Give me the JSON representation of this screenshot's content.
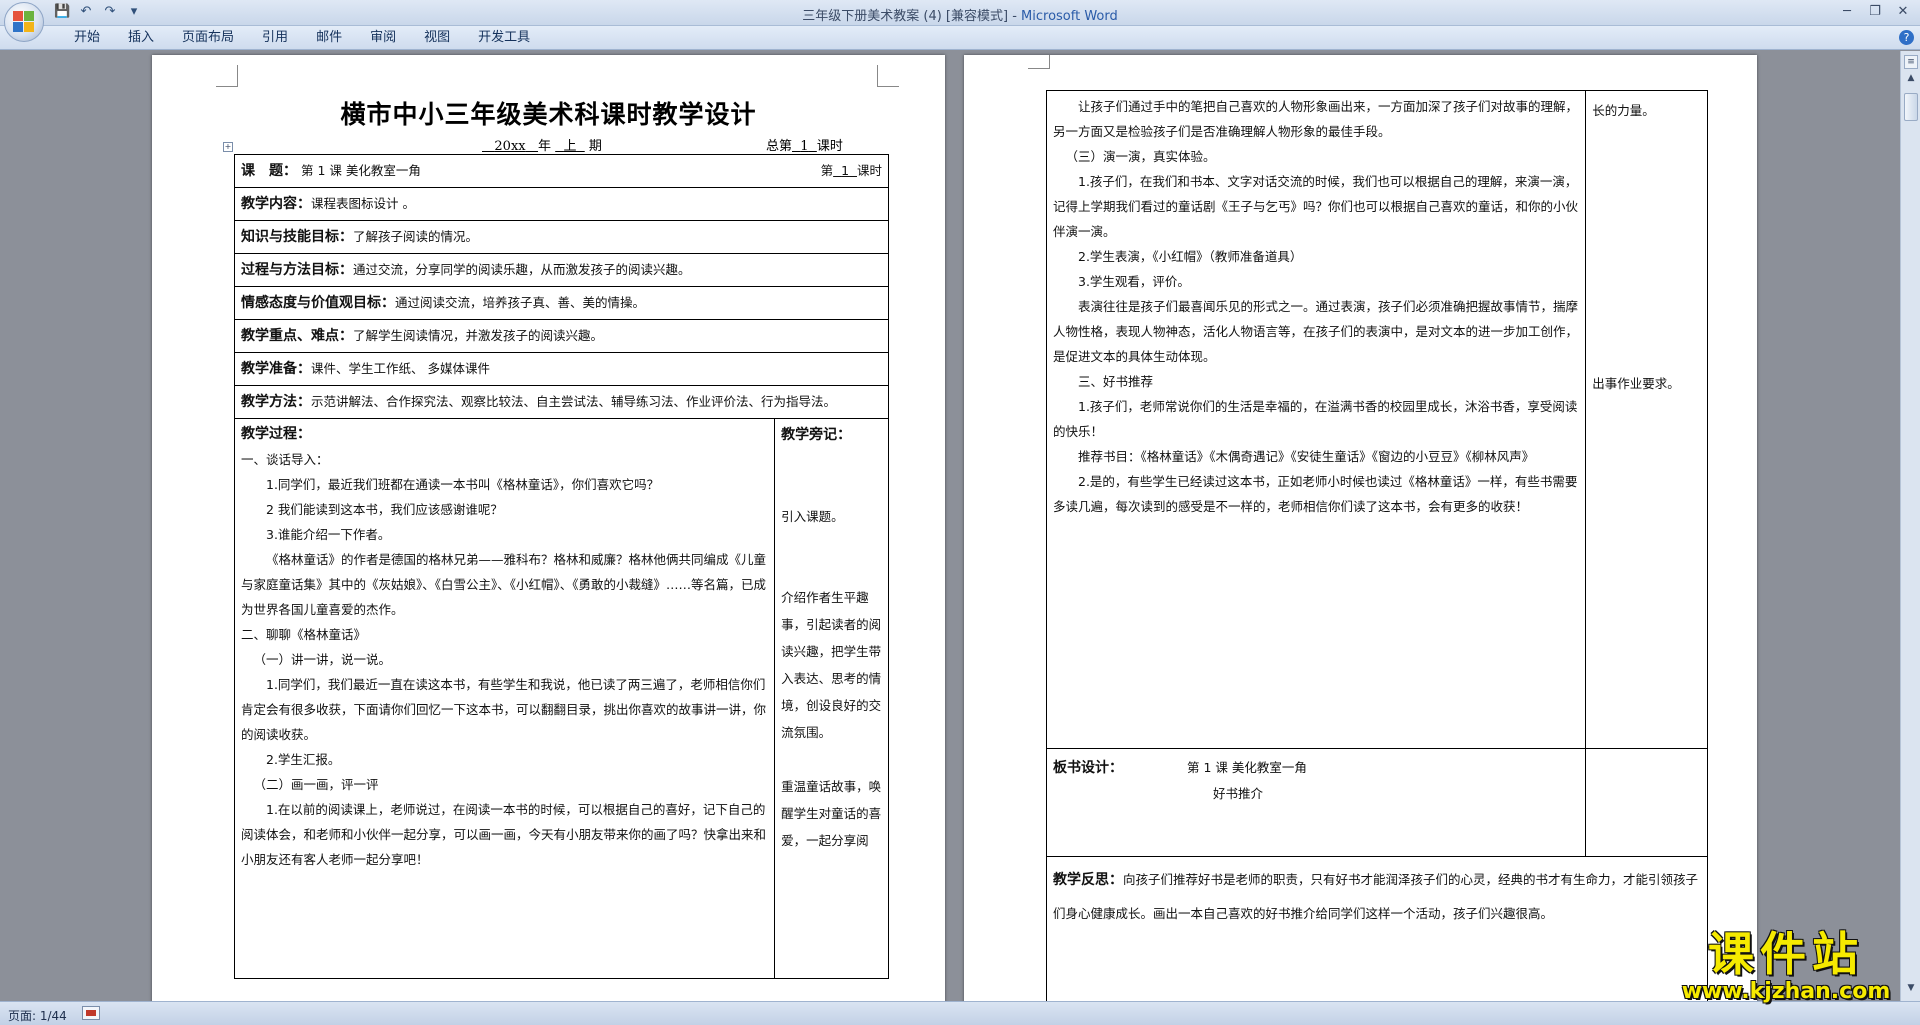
{
  "window": {
    "title": "三年级下册美术教案 (4) [兼容模式]",
    "app_name": "Microsoft Word",
    "title_sep": " - "
  },
  "ribbon": {
    "tabs": [
      "开始",
      "插入",
      "页面布局",
      "引用",
      "邮件",
      "审阅",
      "视图",
      "开发工具"
    ]
  },
  "status": {
    "page": "页面: 1/44"
  },
  "doc": {
    "title": "横市中小三年级美术科课时教学设计",
    "term": {
      "year": "20xx",
      "year_suffix": "年",
      "half": "上",
      "half_suffix": "期",
      "total_prefix": "总第",
      "total_num": "1",
      "total_suffix": "课时"
    },
    "topic_label": "课　题：",
    "topic_value": "第 1 课 美化教室一角",
    "lesson_prefix": "第",
    "lesson_num": "1",
    "lesson_suffix": "课时",
    "rows": [
      {
        "label": "教学内容：",
        "value": "课程表图标设计 。"
      },
      {
        "label": "知识与技能目标：",
        "value": "了解孩子阅读的情况。"
      },
      {
        "label": "过程与方法目标：",
        "value": "通过交流，分享同学的阅读乐趣，从而激发孩子的阅读兴趣。"
      },
      {
        "label": "情感态度与价值观目标：",
        "value": "通过阅读交流，培养孩子真、善、美的情操。"
      },
      {
        "label": "教学重点、难点：",
        "value": "了解学生阅读情况，并激发孩子的阅读兴趣。"
      },
      {
        "label": "教学准备：",
        "value": "课件、学生工作纸、 多媒体课件"
      },
      {
        "label": "教学方法：",
        "value": "示范讲解法、合作探究法、观察比较法、自主尝试法、辅导练习法、作业评价法、行为指导法。"
      }
    ],
    "process_label": "教学过程：",
    "notes_label": "教学旁记：",
    "process": [
      {
        "cls": "",
        "text": "一、谈话导入："
      },
      {
        "cls": "sub",
        "text": "1.同学们，最近我们班都在通读一本书叫《格林童话》，你们喜欢它吗？"
      },
      {
        "cls": "sub",
        "text": "2 我们能读到这本书，我们应该感谢谁呢？"
      },
      {
        "cls": "sub",
        "text": "3.谁能介绍一下作者。"
      },
      {
        "cls": "para",
        "text": "《格林童话》的作者是德国的格林兄弟——雅科布？格林和威廉？格林他俩共同编成《儿童与家庭童话集》其中的《灰姑娘》、《白雪公主》、《小红帽》、《勇敢的小裁缝》……等名篇，已成为世界各国儿童喜爱的杰作。"
      },
      {
        "cls": "",
        "text": "二、聊聊《格林童话》"
      },
      {
        "cls": "sub2",
        "text": "（一）讲一讲，说一说。"
      },
      {
        "cls": "para",
        "text": "1.同学们，我们最近一直在读这本书，有些学生和我说，他已读了两三遍了，老师相信你们肯定会有很多收获，下面请你们回忆一下这本书，可以翻翻目录，挑出你喜欢的故事讲一讲，你的阅读收获。"
      },
      {
        "cls": "sub",
        "text": "2.学生汇报。"
      },
      {
        "cls": "sub2",
        "text": "（二）画一画，评一评"
      },
      {
        "cls": "para",
        "text": "1.在以前的阅读课上，老师说过，在阅读一本书的时候，可以根据自己的喜好，记下自己的阅读体会，和老师和小伙伴一起分享，可以画一画，今天有小朋友带来你的画了吗？快拿出来和小朋友还有客人老师一起分享吧！"
      }
    ],
    "notes": [
      {
        "gap": 2,
        "text": "引入课题。"
      },
      {
        "gap": 2,
        "text": "介绍作者生平趣事，引起读者的阅读兴趣，把学生带入表达、思考的情境，创设良好的交流氛围。"
      },
      {
        "gap": 1,
        "text": "重温童话故事，唤醒学生对童话的喜爱，一起分享阅"
      }
    ]
  },
  "doc2": {
    "main": [
      {
        "cls": "para",
        "text": "让孩子们通过手中的笔把自己喜欢的人物形象画出来，一方面加深了孩子们对故事的理解，另一方面又是检验孩子们是否准确理解人物形象的最佳手段。"
      },
      {
        "cls": "sub2",
        "text": "（三）演一演，真实体验。"
      },
      {
        "cls": "para",
        "text": "1.孩子们，在我们和书本、文字对话交流的时候，我们也可以根据自己的理解，来演一演，记得上学期我们看过的童话剧《王子与乞丐》吗？你们也可以根据自己喜欢的童话，和你的小伙伴演一演。"
      },
      {
        "cls": "sub",
        "text": "2.学生表演，《小红帽》（教师准备道具）"
      },
      {
        "cls": "sub",
        "text": "3.学生观看，评价。"
      },
      {
        "cls": "para",
        "text": "表演往往是孩子们最喜闻乐见的形式之一。通过表演，孩子们必须准确把握故事情节，揣摩人物性格，表现人物神态，活化人物语言等，在孩子们的表演中，是对文本的进一步加工创作，是促进文本的具体生动体现。"
      },
      {
        "cls": "sub",
        "text": "三、好书推荐"
      },
      {
        "cls": "para",
        "text": "1.孩子们，老师常说你们的生活是幸福的，在溢满书香的校园里成长，沐浴书香，享受阅读的快乐！"
      },
      {
        "cls": "para",
        "text": "推荐书目：《格林童话》《木偶奇遇记》《安徒生童话》《窗边的小豆豆》《柳林风声》"
      },
      {
        "cls": "para",
        "text": "2.是的，有些学生已经读过这本书，正如老师小时候也读过《格林童话》一样，有些书需要多读几遍，每次读到的感受是不一样的，老师相信你们读了这本书，会有更多的收获！"
      }
    ],
    "side_top": "长的力量。",
    "side_mid": "出事作业要求。",
    "board_label": "板书设计：",
    "board_line1": "第 1 课 美化教室一角",
    "board_line2": "好书推介",
    "reflect_label": "教学反思：",
    "reflect_text": "向孩子们推荐好书是老师的职责，只有好书才能润泽孩子们的心灵，经典的书才有生命力，才能引领孩子们身心健康成长。画出一本自己喜欢的好书推介给同学们这样一个活动，孩子们兴趣很高。"
  },
  "watermark": {
    "big": "课件站",
    "small": "www.kjzhan.com"
  }
}
